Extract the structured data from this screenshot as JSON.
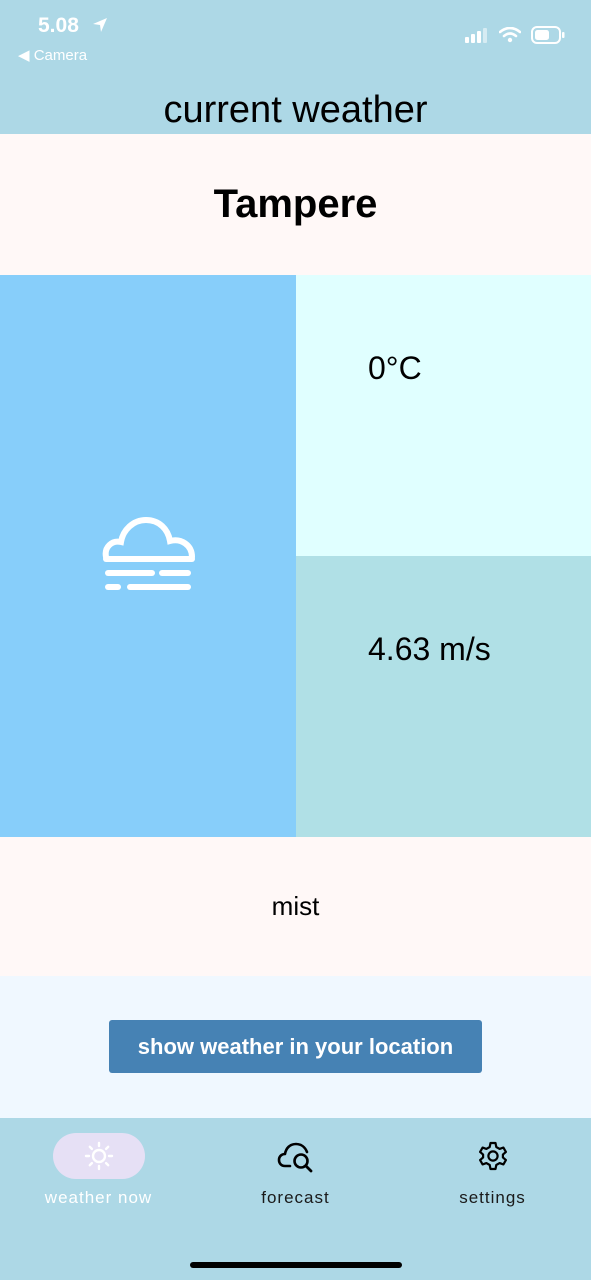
{
  "status_bar": {
    "time": "5.08",
    "back_label": "◀ Camera"
  },
  "header": {
    "title": "current weather"
  },
  "weather": {
    "city": "Tampere",
    "icon": "fog-cloud-icon",
    "temperature": "0°C",
    "wind_speed": "4.63 m/s",
    "description": "mist"
  },
  "actions": {
    "location_button_label": "show weather in your location"
  },
  "tab_bar": {
    "tabs": [
      {
        "label": "weather now",
        "icon": "sun-icon",
        "active": true
      },
      {
        "label": "forecast",
        "icon": "cloud-search-icon",
        "active": false
      },
      {
        "label": "settings",
        "icon": "gear-icon",
        "active": false
      }
    ]
  },
  "colors": {
    "status_bar_bg": "#add8e6",
    "city_panel_bg": "#fff8f7",
    "icon_panel_bg": "#87cefa",
    "temp_panel_bg": "#e0ffff",
    "wind_panel_bg": "#b0e0e6",
    "action_panel_bg": "#f0f8ff",
    "button_bg": "#4682b4",
    "active_tab_indicator": "#e6e0f5"
  }
}
